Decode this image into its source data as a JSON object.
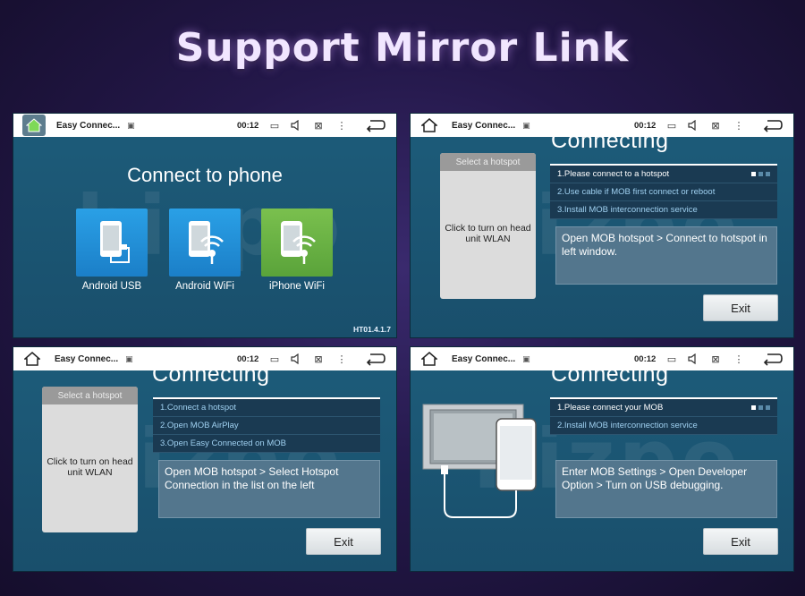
{
  "banner": {
    "title": "Support Mirror Link"
  },
  "screens": [
    {
      "status": {
        "title": "Easy Connec...",
        "time": "00:12"
      },
      "main_title": "Connect to phone",
      "apps": [
        {
          "label": "Android USB"
        },
        {
          "label": "Android WiFi"
        },
        {
          "label": "iPhone WiFi"
        }
      ],
      "version": "HT01.4.1.7"
    },
    {
      "status": {
        "title": "Easy Connec...",
        "time": "00:12"
      },
      "heading": "Connecting",
      "left_panel": {
        "header": "Select a hotspot",
        "text": "Click to turn on head unit WLAN"
      },
      "steps": [
        "1.Please connect to a hotspot",
        "2.Use cable if MOB first connect or reboot",
        "3.Install MOB interconnection service"
      ],
      "description": "Open MOB hotspot > Connect to hotspot in left window.",
      "exit_label": "Exit"
    },
    {
      "status": {
        "title": "Easy Connec...",
        "time": "00:12"
      },
      "heading": "Connecting",
      "left_panel": {
        "header": "Select a hotspot",
        "text": "Click to turn on head unit WLAN"
      },
      "steps": [
        "1.Connect a hotspot",
        "2.Open MOB AirPlay",
        "3.Open Easy Connected on MOB"
      ],
      "description": "Open MOB hotspot > Select Hotspot Connection in the list on the left",
      "exit_label": "Exit"
    },
    {
      "status": {
        "title": "Easy Connec...",
        "time": "00:12"
      },
      "heading": "Connecting",
      "steps": [
        "1.Please connect your MOB",
        "2.Install MOB interconnection service"
      ],
      "description": "Enter MOB Settings > Open Developer Option > Turn on USB debugging.",
      "exit_label": "Exit"
    }
  ],
  "icons": {
    "home": "home-icon",
    "image": "image-icon",
    "screenshot": "screenshot-icon",
    "volume": "volume-icon",
    "close": "close-box-icon",
    "menu": "menu-dots-icon",
    "back": "back-arrow-icon"
  },
  "colors": {
    "screen_bg": "#1d5c7a",
    "android_tile": "#1b7fc8",
    "iphone_tile": "#5aa33a",
    "banner_bg": "#24184a"
  }
}
